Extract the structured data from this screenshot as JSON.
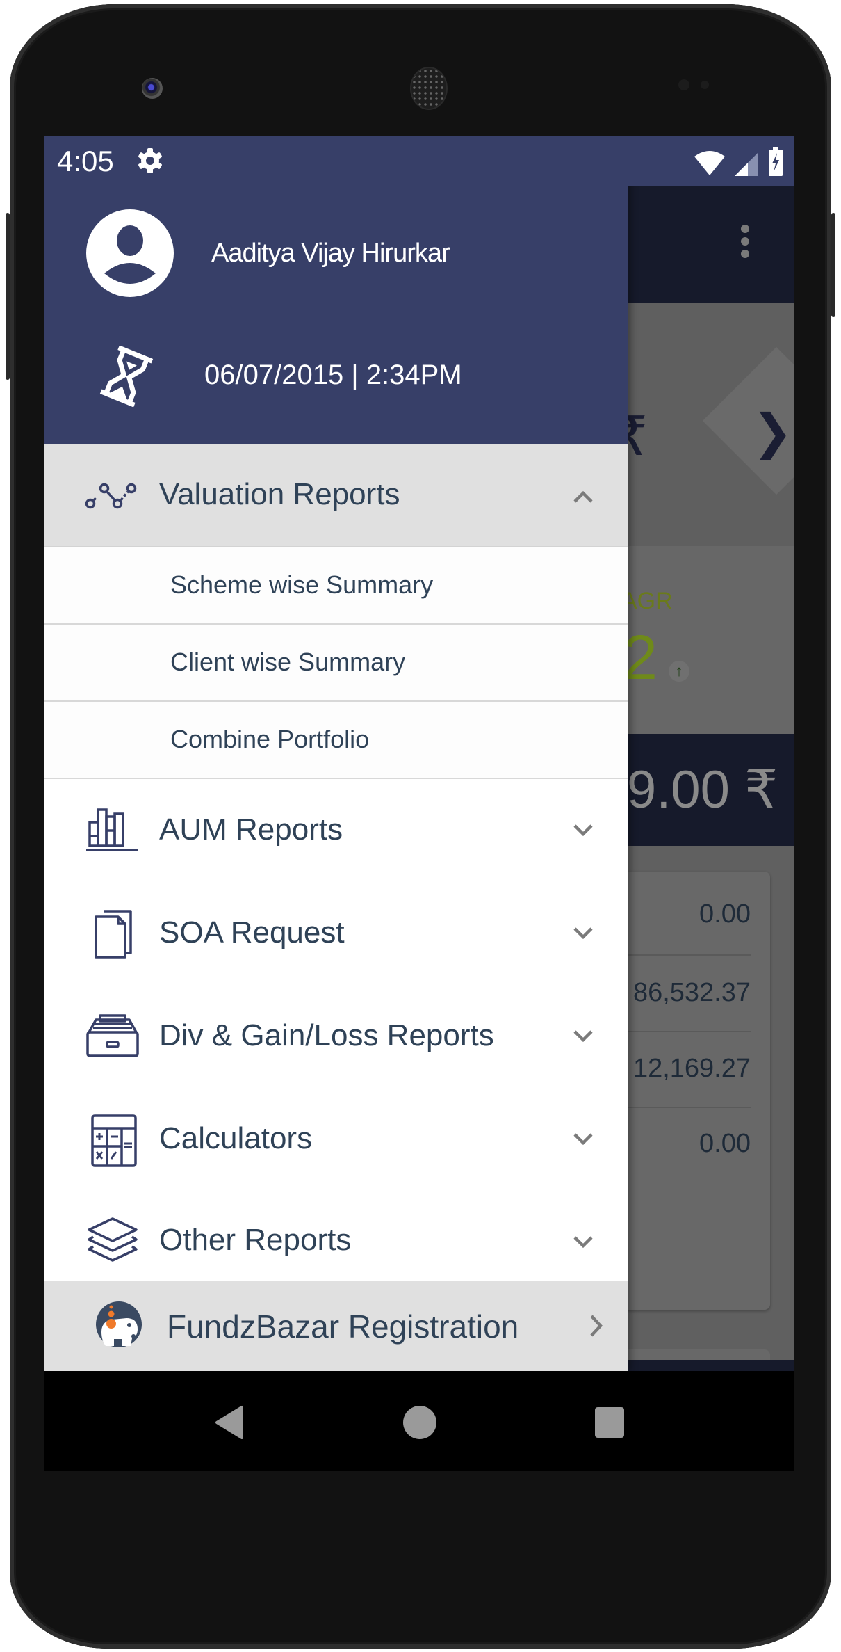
{
  "status_bar": {
    "time": "4:05",
    "icons": [
      "gear-icon",
      "wifi-icon",
      "signal-icon",
      "battery-charging-icon"
    ]
  },
  "drawer": {
    "header": {
      "user_name": "Aaditya Vijay Hirurkar",
      "last_login": "06/07/2015 | 2:34PM"
    },
    "menu": [
      {
        "label": "Valuation Reports",
        "icon": "line-chart-icon",
        "expanded": true,
        "children": [
          "Scheme wise Summary",
          "Client wise Summary",
          "Combine Portfolio"
        ]
      },
      {
        "label": "AUM Reports",
        "icon": "bar-chart-icon",
        "expanded": false
      },
      {
        "label": "SOA Request",
        "icon": "documents-icon",
        "expanded": false
      },
      {
        "label": "Div & Gain/Loss Reports",
        "icon": "inbox-tray-icon",
        "expanded": false
      },
      {
        "label": "Calculators",
        "icon": "calculator-icon",
        "expanded": false
      },
      {
        "label": "Other Reports",
        "icon": "layers-icon",
        "expanded": false
      }
    ],
    "footer": {
      "label": "FundzBazar Registration",
      "icon": "fundzbazar-logo-icon"
    }
  },
  "background_app": {
    "hero_symbol": "₹",
    "cagr_label": "AGR",
    "cagr_value": "2",
    "total_value": "9.00 ₹",
    "rows": [
      "0.00",
      "86,532.37",
      "12,169.27",
      "0.00"
    ]
  },
  "colors": {
    "header": "#373f68",
    "menu_text": "#2f4257",
    "icon_stroke": "#373f68",
    "expanded_bg": "#e0e0e0",
    "fundzbazar_orange": "#f07a2a"
  }
}
